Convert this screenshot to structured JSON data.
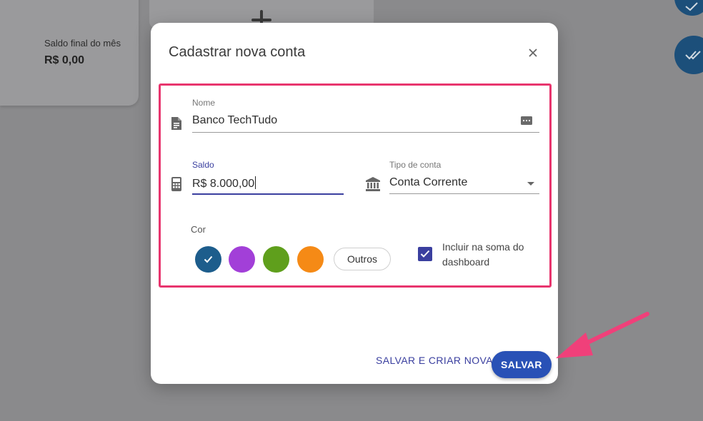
{
  "background": {
    "card_label": "Saldo final do mês",
    "card_value": "R$ 0,00"
  },
  "modal": {
    "title": "Cadastrar nova conta",
    "fields": {
      "nome": {
        "label": "Nome",
        "value": "Banco TechTudo"
      },
      "saldo": {
        "label": "Saldo",
        "value": "R$ 8.000,00"
      },
      "tipo": {
        "label": "Tipo de conta",
        "value": "Conta Corrente"
      }
    },
    "cor": {
      "label": "Cor",
      "swatches": [
        {
          "name": "blue",
          "color": "#1d5d8c",
          "selected": true
        },
        {
          "name": "purple",
          "color": "#a23fd8",
          "selected": false
        },
        {
          "name": "green",
          "color": "#5f9f1c",
          "selected": false
        },
        {
          "name": "orange",
          "color": "#f58a16",
          "selected": false
        }
      ],
      "outros_label": "Outros"
    },
    "include_checkbox": {
      "label": "Incluir na soma do dashboard",
      "checked": true
    },
    "buttons": {
      "save_and_new": "SALVAR E CRIAR NOVA",
      "save": "SALVAR"
    }
  },
  "colors": {
    "primary": "#2951b6",
    "accent": "#3a3f9f",
    "highlight": "#e8356e"
  }
}
